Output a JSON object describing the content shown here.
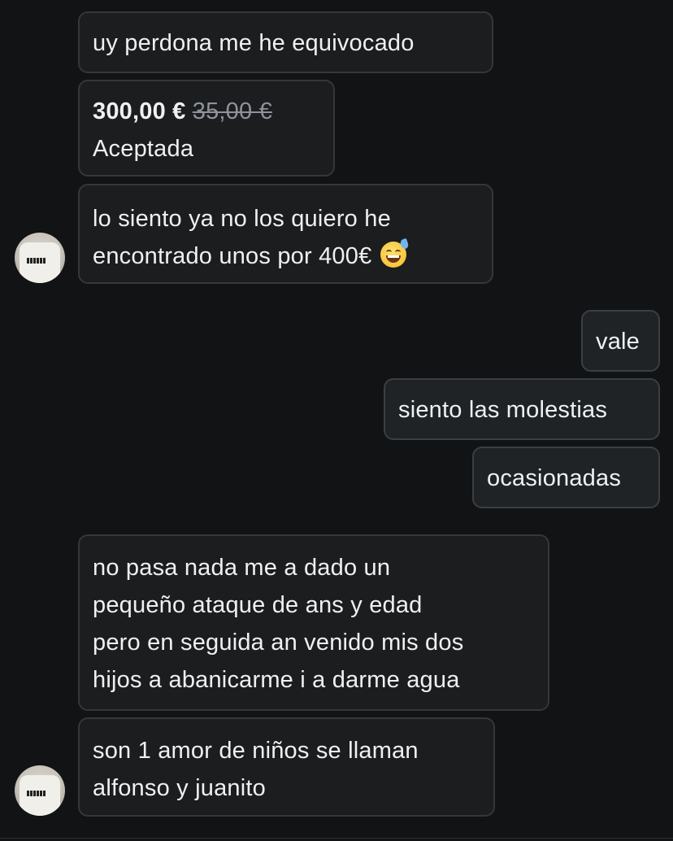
{
  "messages": {
    "m1": {
      "text": "uy perdona me he equivocado"
    },
    "m2": {
      "offer_price": "300,00 €",
      "original_price": "35,00 €",
      "status": "Aceptada"
    },
    "m3": {
      "lines": [
        "lo siento ya no los quiero he",
        "encontrado unos por 400€"
      ],
      "emoji": "grinning-face-with-sweat"
    },
    "m4": {
      "text": "vale"
    },
    "m5": {
      "text": "siento las molestias"
    },
    "m6": {
      "text": "ocasionadas"
    },
    "m7": {
      "lines": [
        "no pasa nada me a dado un",
        "pequeño ataque de ans y edad",
        "pero en seguida an venido mis dos",
        "hijos a abanicarme i a darme agua"
      ]
    },
    "m8": {
      "lines": [
        "son 1 amor de niños se llaman",
        "alfonso y juanito"
      ]
    }
  },
  "colors": {
    "background": "#121314",
    "bubble": "#1b1d1f",
    "bubble_border": "#34373b",
    "text": "#eef0f2",
    "strikethrough_text": "#8d9398"
  }
}
